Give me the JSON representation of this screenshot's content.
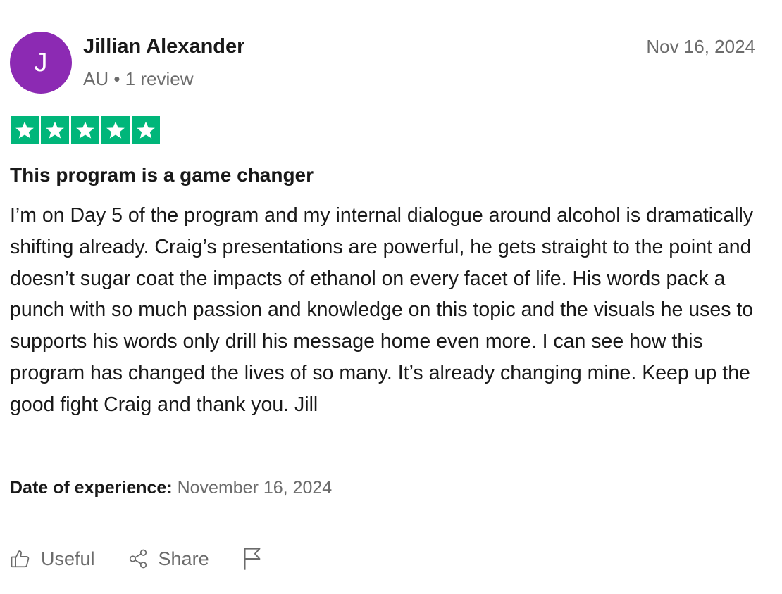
{
  "reviewer": {
    "initial": "J",
    "avatar_color": "#8c2ab3",
    "name": "Jillian Alexander",
    "meta": "AU • 1 review"
  },
  "review_date": "Nov 16, 2024",
  "rating": {
    "stars": 5,
    "max": 5,
    "color": "#00b67a",
    "icon": "star-icon"
  },
  "review": {
    "title": "This program is a game changer",
    "body": "I’m on Day 5 of the program and my internal dialogue around alcohol is dramatically shifting already. Craig’s presentations are powerful, he gets straight to the point and doesn’t sugar coat the impacts of ethanol on every facet of life. His words pack a punch with so much passion and knowledge on this topic and the visuals he uses to supports his words only drill his message home even more. I can see how this program has changed the lives of so many. It’s already changing mine. Keep up the good fight Craig and thank you. Jill"
  },
  "experience": {
    "label": "Date of experience:",
    "value": "November 16, 2024"
  },
  "actions": {
    "useful_label": "Useful",
    "useful_icon": "thumbs-up-icon",
    "share_label": "Share",
    "share_icon": "share-icon",
    "report_icon": "flag-icon"
  }
}
